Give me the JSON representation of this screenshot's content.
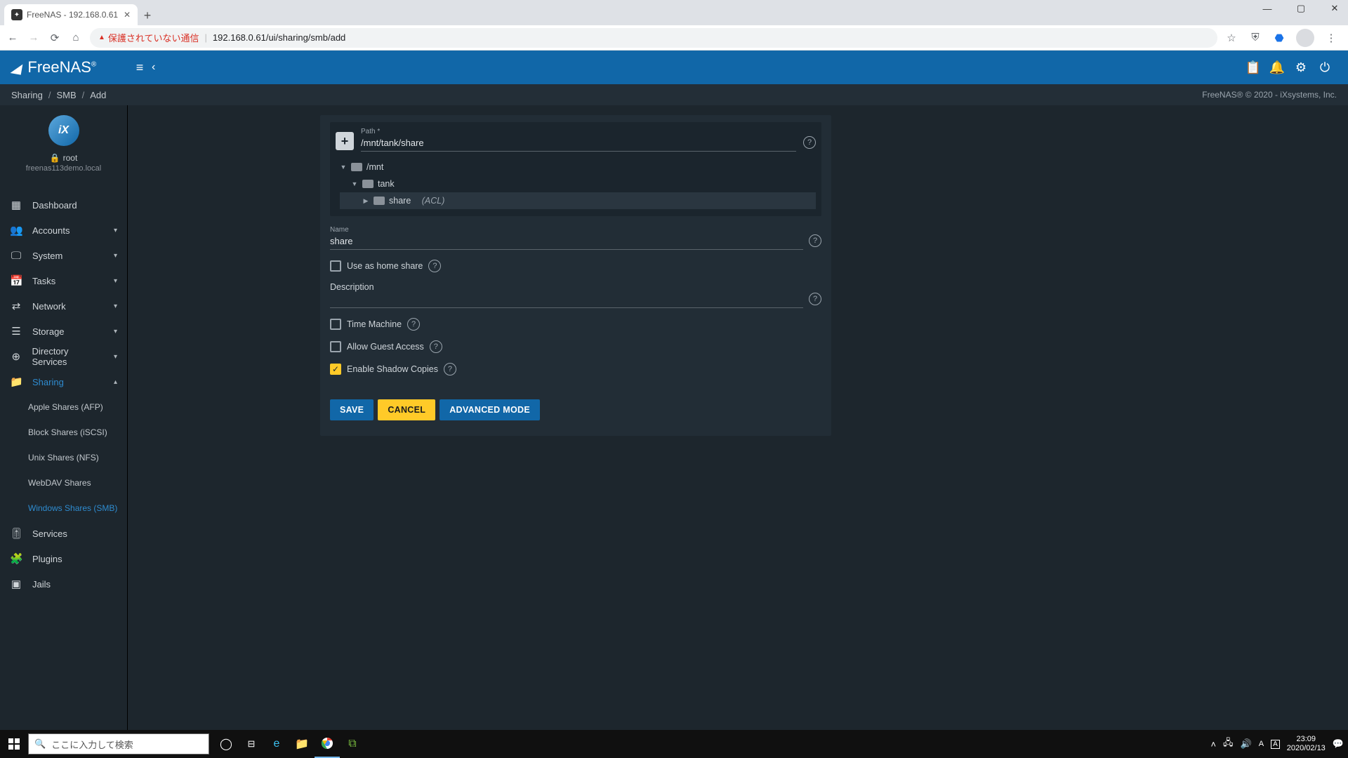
{
  "browser": {
    "tab_title": "FreeNAS - 192.168.0.61",
    "insecure_label": "保護されていない通信",
    "url": "192.168.0.61/ui/sharing/smb/add"
  },
  "topbar": {
    "brand": "FreeNAS",
    "brand_tm": "®"
  },
  "breadcrumb": {
    "a": "Sharing",
    "b": "SMB",
    "c": "Add"
  },
  "copyright": "FreeNAS® © 2020 - iXsystems, Inc.",
  "sidebar": {
    "logo_text": "iX",
    "user": "root",
    "host": "freenas113demo.local",
    "dashboard": "Dashboard",
    "accounts": "Accounts",
    "system": "System",
    "tasks": "Tasks",
    "network": "Network",
    "storage": "Storage",
    "directory": "Directory Services",
    "sharing": "Sharing",
    "sub_afp": "Apple Shares (AFP)",
    "sub_iscsi": "Block Shares (iSCSI)",
    "sub_nfs": "Unix Shares (NFS)",
    "sub_webdav": "WebDAV Shares",
    "sub_smb": "Windows Shares (SMB)",
    "services": "Services",
    "plugins": "Plugins",
    "jails": "Jails"
  },
  "form": {
    "path_label": "Path *",
    "path_value": "/mnt/tank/share",
    "tree_mnt": "/mnt",
    "tree_tank": "tank",
    "tree_share": "share",
    "tree_share_suffix": "(ACL)",
    "name_label": "Name",
    "name_value": "share",
    "home_label": "Use as home share",
    "desc_label": "Description",
    "desc_value": "",
    "tm_label": "Time Machine",
    "guest_label": "Allow Guest Access",
    "shadow_label": "Enable Shadow Copies",
    "btn_save": "SAVE",
    "btn_cancel": "CANCEL",
    "btn_advanced": "ADVANCED MODE"
  },
  "taskbar": {
    "search_placeholder": "ここに入力して検索",
    "time": "23:09",
    "date": "2020/02/13"
  }
}
